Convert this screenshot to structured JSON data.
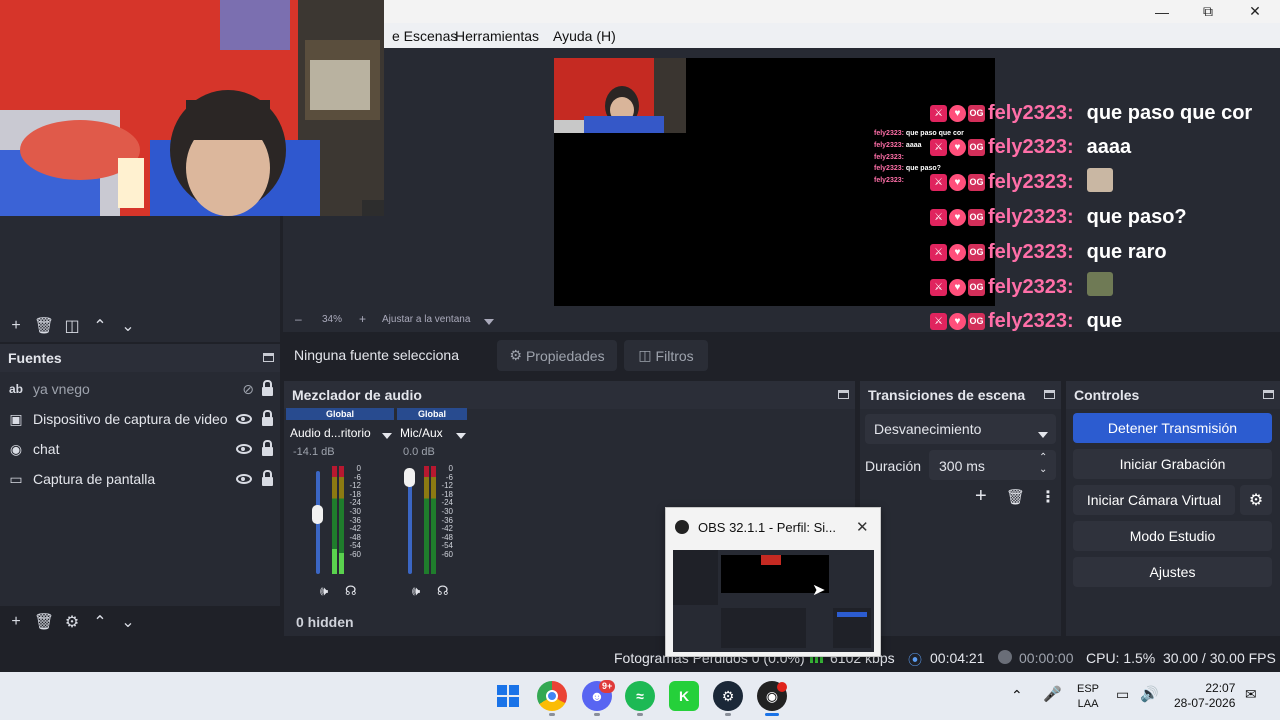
{
  "window": {
    "title_bar_controls": [
      "minimize-icon",
      "maximize-icon",
      "close-icon"
    ],
    "menu": [
      "e Escenas",
      "Herramientas",
      "Ayuda (H)"
    ]
  },
  "preview": {
    "zoom": "34%",
    "fit_label": "Ajustar a la ventana"
  },
  "chat": {
    "user": "fely2323:",
    "badge_text": "OG",
    "messages": [
      "que paso que cor",
      "aaaa",
      "",
      "que paso?",
      "que raro",
      "",
      "que",
      "que paso"
    ],
    "mini_user": "fely2323:",
    "mini_messages": [
      "que paso que cor",
      "aaaa",
      "",
      "que paso?",
      ""
    ]
  },
  "sources": {
    "title": "Fuentes",
    "items": [
      {
        "label": "ya vnego",
        "icon": "text-icon",
        "visible": false
      },
      {
        "label": "Dispositivo de captura de video",
        "icon": "camera-icon",
        "visible": true
      },
      {
        "label": "chat",
        "icon": "browser-icon",
        "visible": true
      },
      {
        "label": "Captura de pantalla",
        "icon": "monitor-icon",
        "visible": true
      }
    ]
  },
  "context_bar": {
    "no_source": "Ninguna fuente selecciona",
    "properties": "Propiedades",
    "filters": "Filtros"
  },
  "mixer": {
    "title": "Mezclador de audio",
    "channels": [
      {
        "head": "Global",
        "name": "Audio d...ritorio",
        "db": "-14.1 dB",
        "level": 0.78
      },
      {
        "head": "Global",
        "name": "Mic/Aux",
        "db": "0.0 dB",
        "level": 1.0
      }
    ],
    "scale": [
      "0",
      "-6",
      "-12",
      "-18",
      "-24",
      "-30",
      "-36",
      "-42",
      "-48",
      "-54",
      "-60"
    ],
    "hidden": "0 hidden"
  },
  "transitions": {
    "title": "Transiciones de escena",
    "selected": "Desvanecimiento",
    "duration_label": "Duración",
    "duration_value": "300 ms"
  },
  "controls": {
    "title": "Controles",
    "stop_stream": "Detener Transmisión",
    "start_recording": "Iniciar Grabación",
    "start_virtualcam": "Iniciar Cámara Virtual",
    "studio_mode": "Modo Estudio",
    "settings": "Ajustes"
  },
  "status": {
    "dropped": "Fotogramas Perdidos 0 (0.0%)",
    "bitrate": "6102 kbps",
    "stream_time": "00:04:21",
    "rec_time": "00:00:00",
    "cpu": "CPU: 1.5%",
    "fps": "30.00 / 30.00 FPS"
  },
  "popup": {
    "title": "OBS 32.1.1 - Perfil: Si..."
  },
  "taskbar": {
    "discord_badge": "9+",
    "lang_top": "ESP",
    "lang_bottom": "LAA",
    "time": "22:07",
    "date": "28-07-2026"
  },
  "colors": {
    "accent": "#284b8f",
    "active_button": "#2c5cd0",
    "chat_user": "#ff6fa8"
  }
}
